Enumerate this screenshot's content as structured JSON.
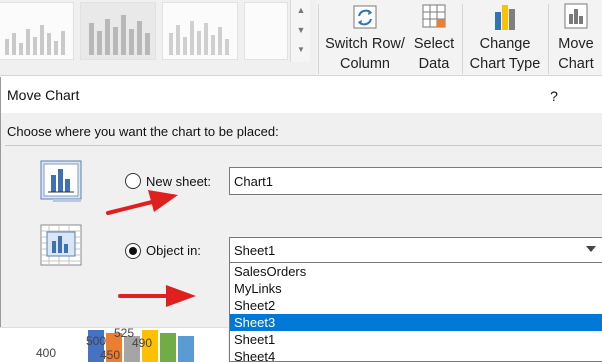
{
  "ribbon": {
    "switch_row_column": "Switch Row/\nColumn",
    "select_data": "Select\nData",
    "change_chart_type": "Change\nChart Type",
    "move_chart": "Move\nChart"
  },
  "dialog": {
    "title": "Move Chart",
    "help": "?",
    "instruction": "Choose where you want the chart to be placed:",
    "new_sheet": {
      "label": "New sheet:",
      "value": "Chart1",
      "selected": false
    },
    "object_in": {
      "label": "Object in:",
      "value": "Sheet1",
      "selected": true
    },
    "dropdown_options": [
      "SalesOrders",
      "MyLinks",
      "Sheet2",
      "Sheet3",
      "Sheet1",
      "Sheet4"
    ],
    "highlighted_option": "Sheet3"
  },
  "chart_remnant": {
    "axis_label": "400",
    "data_labels": [
      "500",
      "525",
      "490",
      "450"
    ],
    "bar_colors": [
      "#4472c4",
      "#ed7d31",
      "#a5a5a5",
      "#ffc000",
      "#70ad47",
      "#5b9bd5"
    ]
  },
  "colors": {
    "accent": "#0078d7",
    "annotation_arrow": "#e0201e"
  },
  "icons": {
    "new_sheet": "chart-sheet-icon",
    "object_in": "embedded-chart-icon",
    "help": "help-icon"
  }
}
